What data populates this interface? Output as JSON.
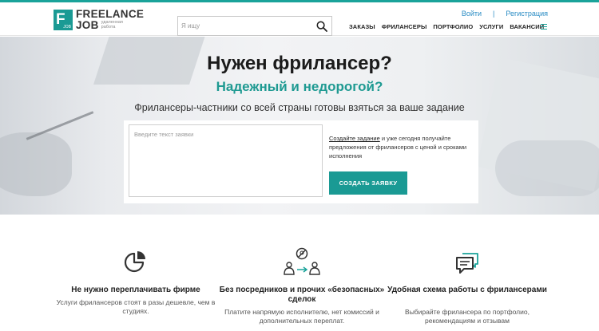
{
  "logo": {
    "line1": "FREELANCE",
    "line2": "JOB",
    "mark_letter": "F",
    "mark_small": "JOB",
    "tagline": "удаленная работа"
  },
  "search": {
    "placeholder": "Я ищу"
  },
  "auth": {
    "login": "Войти",
    "separator": "|",
    "register": "Регистрация"
  },
  "nav": {
    "items": [
      "ЗАКАЗЫ",
      "ФРИЛАНСЕРЫ",
      "ПОРТФОЛИО",
      "УСЛУГИ",
      "ВАКАНСИИ"
    ]
  },
  "hero": {
    "title": "Нужен фрилансер?",
    "subtitle": "Надежный и недорогой?",
    "description": "Фрилансеры-частники со всей страны готовы взяться за ваше задание"
  },
  "order": {
    "textarea_placeholder": "Введите текст заявки",
    "info_link": "Создайте задание",
    "info_text": " и уже сегодня получайте предложения от фрилансеров с ценой и сроками исполнения",
    "button_label": "СОЗДАТЬ ЗАЯВКУ"
  },
  "features": [
    {
      "icon": "pie-chart-icon",
      "title": "Не нужно переплачивать фирме",
      "text": "Услуги фрилансеров стоят в разы дешевле, чем в студиях."
    },
    {
      "icon": "no-middleman-icon",
      "title": "Без посредников и прочих «безопасных» сделок",
      "text": "Платите напрямую исполнителю, нет комиссий и дополнительных переплат."
    },
    {
      "icon": "chat-bubbles-icon",
      "title": "Удобная схема работы с фрилансерами",
      "text": "Выбирайте фрилансера по портфолио, рекомендациям и отзывам"
    }
  ],
  "colors": {
    "accent": "#1aa39a",
    "link": "#2a8cc4",
    "text": "#222222"
  }
}
